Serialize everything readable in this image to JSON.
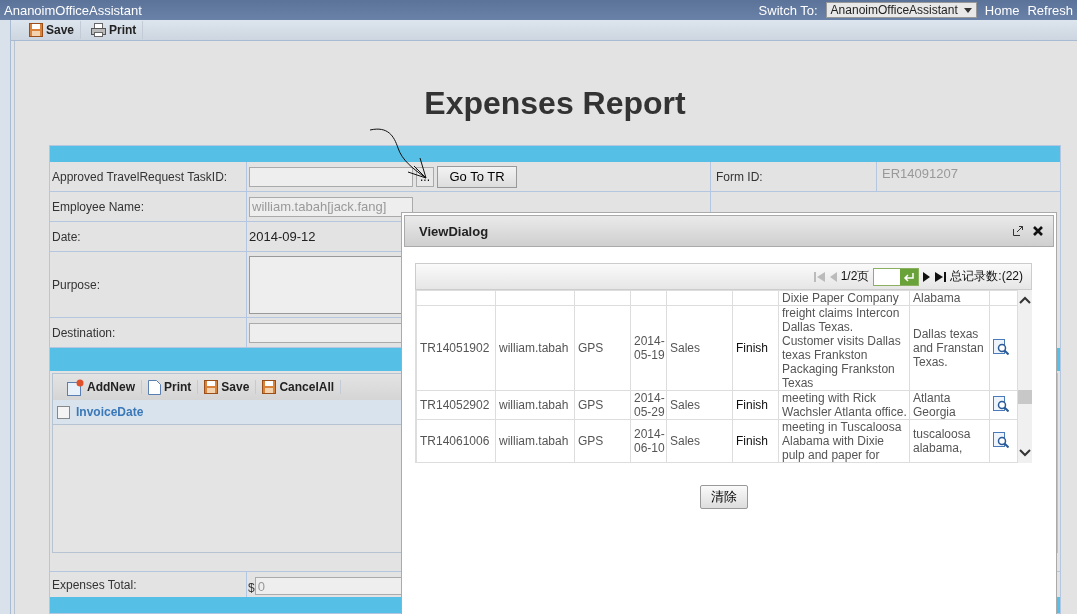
{
  "header": {
    "app_title": "AnanoimOfficeAssistant",
    "switch_label": "Switch To:",
    "app_select": "AnanoimOfficeAssistant",
    "links": [
      "Home",
      "Refresh"
    ]
  },
  "toolbar": [
    {
      "label": "Save",
      "kind": "save"
    },
    {
      "label": "Print",
      "kind": "print"
    }
  ],
  "title": "Expenses Report",
  "form": {
    "fields": [
      {
        "kind": "lookup",
        "label": "Approved TravelRequest TaskID:",
        "lookup_button": "...",
        "go_button": "Go To TR"
      },
      {
        "kind": "readonly",
        "label": "Employee Name:",
        "value": "william.tabah[jack.fang]",
        "disabled": true
      },
      {
        "kind": "date",
        "label": "Date:",
        "value": "2014-09-12"
      },
      {
        "kind": "textarea",
        "label": "Purpose:"
      },
      {
        "kind": "text",
        "label": "Destination:"
      }
    ],
    "side_fields": [
      {
        "label": "Form ID:",
        "value": "ER14091207"
      }
    ]
  },
  "grid": {
    "toolbar": [
      {
        "label": "AddNew",
        "kind": "add"
      },
      {
        "label": "Print",
        "kind": "print"
      },
      {
        "label": "Save",
        "kind": "save"
      },
      {
        "label": "CancelAll",
        "kind": "save"
      }
    ],
    "select_all_checked": false,
    "columns": [
      "InvoiceDate"
    ]
  },
  "total": {
    "label": "Expenses Total:",
    "currency": "$",
    "value": "0",
    "disabled": true
  },
  "dialog": {
    "title": "ViewDialog",
    "pager": {
      "page": "1/2页",
      "total": "总记录数:(22)"
    },
    "rows": [
      {
        "kind": "partial",
        "purpose": "Dixie Paper Company",
        "destination": "Alabama"
      },
      {
        "kind": "full",
        "id": "TR14051902",
        "user": "william.tabah",
        "company": "GPS",
        "date": "2014-05-19",
        "dept": "Sales",
        "status": "Finish",
        "purpose": "freight claims Intercon Dallas Texas. Customer visits Dallas texas Frankston Packaging Frankston Texas",
        "destination": "Dallas texas and Franstan Texas."
      },
      {
        "kind": "full",
        "id": "TR14052902",
        "user": "william.tabah",
        "company": "GPS",
        "date": "2014-05-29",
        "dept": "Sales",
        "status": "Finish",
        "purpose": "meeting with Rick Wachsler Atlanta office.",
        "destination": "Atlanta Georgia"
      },
      {
        "kind": "full",
        "id": "TR14061006",
        "user": "william.tabah",
        "company": "GPS",
        "date": "2014-06-10",
        "dept": "Sales",
        "status": "Finish",
        "purpose": "meeting in Tuscaloosa Alabama with Dixie pulp and paper for",
        "destination": "tuscaloosa alabama,"
      }
    ],
    "clear_button": "清除"
  }
}
